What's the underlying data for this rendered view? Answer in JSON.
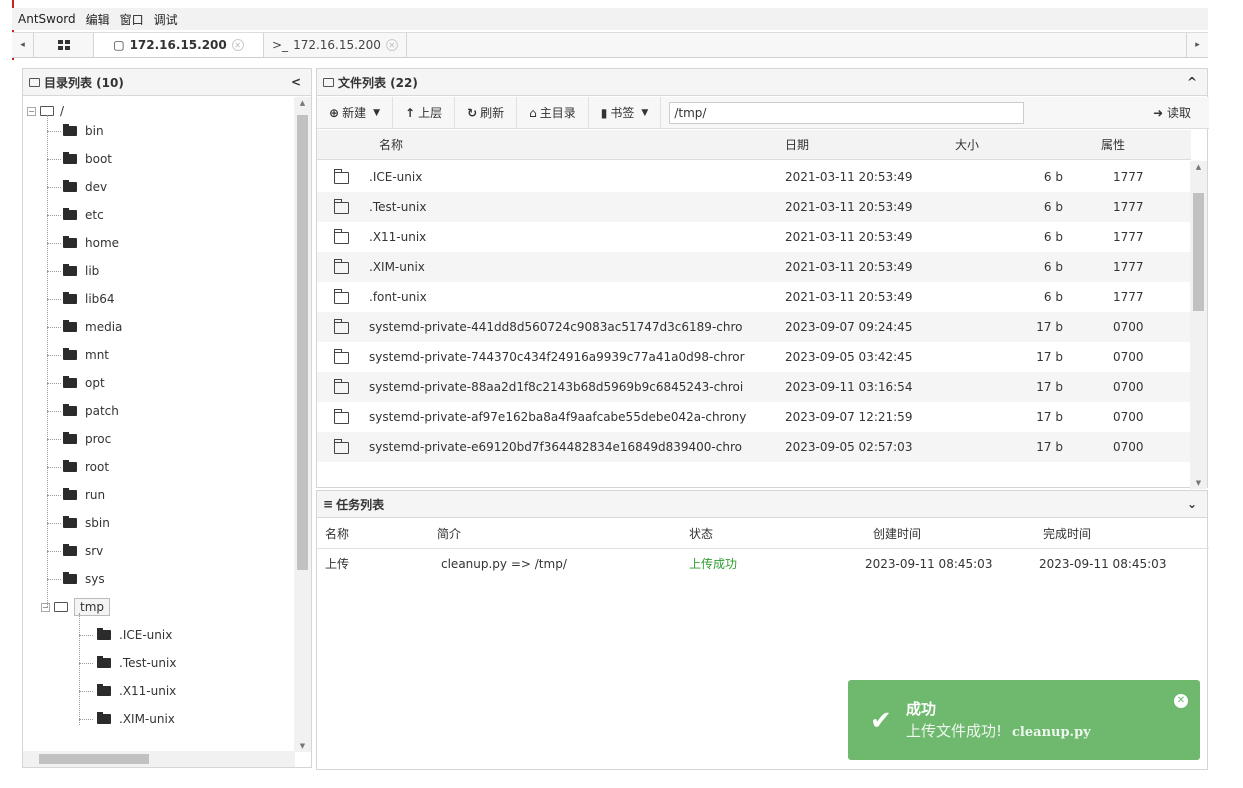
{
  "menu": [
    "AntSword",
    "编辑",
    "窗口",
    "调试"
  ],
  "tabs": {
    "left_arrow": "◂",
    "right_arrow": "▸",
    "active": {
      "icon": "▢",
      "label": "172.16.15.200"
    },
    "terminal": {
      "icon": ">_",
      "label": "172.16.15.200"
    }
  },
  "dir_panel": {
    "title": "目录列表 (10)",
    "collapse": "<",
    "root": "/",
    "items": [
      "bin",
      "boot",
      "dev",
      "etc",
      "home",
      "lib",
      "lib64",
      "media",
      "mnt",
      "opt",
      "patch",
      "proc",
      "root",
      "run",
      "sbin",
      "srv",
      "sys"
    ],
    "tmp": "tmp",
    "tmp_children": [
      ".ICE-unix",
      ".Test-unix",
      ".X11-unix",
      ".XIM-unix"
    ]
  },
  "file_panel": {
    "title": "文件列表 (22)",
    "collapse": "^",
    "toolbar": {
      "new": "新建",
      "up": "上层",
      "refresh": "刷新",
      "home": "主目录",
      "bookmark": "书签",
      "path": "/tmp/",
      "read": "读取"
    },
    "columns": {
      "name": "名称",
      "date": "日期",
      "size": "大小",
      "attr": "属性"
    },
    "rows": [
      {
        "name": ".ICE-unix",
        "date": "2021-03-11 20:53:49",
        "size": "6 b",
        "attr": "1777"
      },
      {
        "name": ".Test-unix",
        "date": "2021-03-11 20:53:49",
        "size": "6 b",
        "attr": "1777"
      },
      {
        "name": ".X11-unix",
        "date": "2021-03-11 20:53:49",
        "size": "6 b",
        "attr": "1777"
      },
      {
        "name": ".XIM-unix",
        "date": "2021-03-11 20:53:49",
        "size": "6 b",
        "attr": "1777"
      },
      {
        "name": ".font-unix",
        "date": "2021-03-11 20:53:49",
        "size": "6 b",
        "attr": "1777"
      },
      {
        "name": "systemd-private-441dd8d560724c9083ac51747d3c6189-chro",
        "date": "2023-09-07 09:24:45",
        "size": "17 b",
        "attr": "0700"
      },
      {
        "name": "systemd-private-744370c434f24916a9939c77a41a0d98-chror",
        "date": "2023-09-05 03:42:45",
        "size": "17 b",
        "attr": "0700"
      },
      {
        "name": "systemd-private-88aa2d1f8c2143b68d5969b9c6845243-chroi",
        "date": "2023-09-11 03:16:54",
        "size": "17 b",
        "attr": "0700"
      },
      {
        "name": "systemd-private-af97e162ba8a4f9aafcabe55debe042a-chrony",
        "date": "2023-09-07 12:21:59",
        "size": "17 b",
        "attr": "0700"
      },
      {
        "name": "systemd-private-e69120bd7f364482834e16849d839400-chro",
        "date": "2023-09-05 02:57:03",
        "size": "17 b",
        "attr": "0700"
      }
    ]
  },
  "task_panel": {
    "title": "任务列表",
    "collapse": "⌄",
    "columns": {
      "name": "名称",
      "desc": "简介",
      "status": "状态",
      "created": "创建时间",
      "done": "完成时间"
    },
    "row": {
      "name": "上传",
      "desc": "cleanup.py => /tmp/",
      "status": "上传成功",
      "created": "2023-09-11 08:45:03",
      "done": "2023-09-11 08:45:03"
    }
  },
  "toast": {
    "title": "成功",
    "message": "上传文件成功!",
    "file": "cleanup.py",
    "check": "✔",
    "close": "✕"
  },
  "colors": {
    "success": "#6eb96e",
    "status_ok": "#2e9e2e"
  }
}
